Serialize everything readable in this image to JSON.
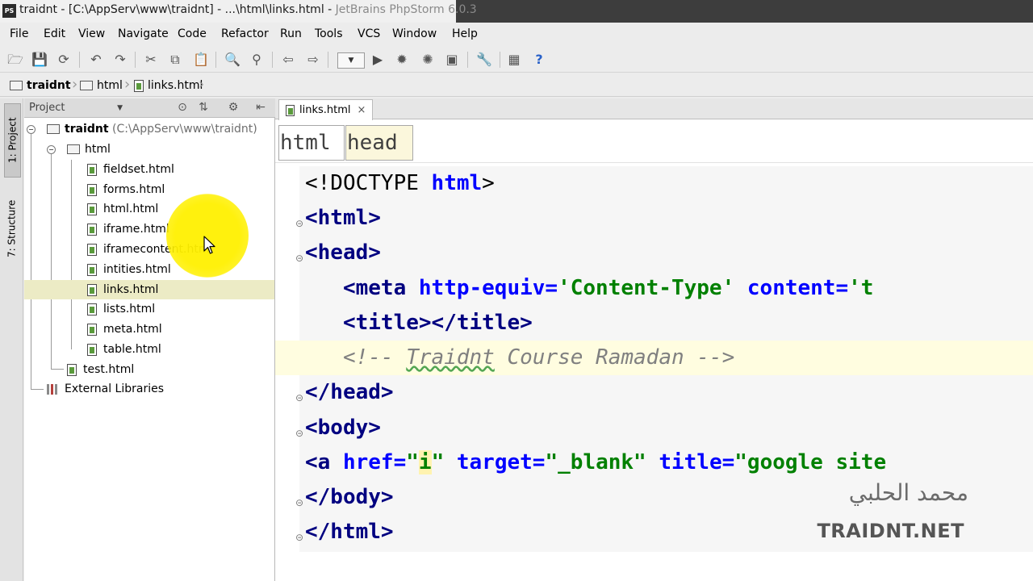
{
  "window": {
    "title_main": "traidnt - [C:\\AppServ\\www\\traidnt] - ...\\html\\links.html - ",
    "title_app": "JetBrains PhpStorm 6.0.3",
    "app_icon_text": "PS"
  },
  "menu": [
    "File",
    "Edit",
    "View",
    "Navigate",
    "Code",
    "Refactor",
    "Run",
    "Tools",
    "VCS",
    "Window",
    "Help"
  ],
  "toolbar": {
    "icons": [
      "open-folder-icon",
      "save-all-icon",
      "synchronize-icon",
      "undo-icon",
      "redo-icon",
      "cut-icon",
      "copy-icon",
      "paste-icon",
      "find-icon",
      "replace-icon",
      "back-icon",
      "forward-icon",
      "run-icon",
      "debug-icon",
      "coverage-icon",
      "stop-icon",
      "settings-icon",
      "project-structure-icon",
      "help-icon"
    ],
    "run_config_label": "▼",
    "help_label": "?"
  },
  "breadcrumb": {
    "project": "traidnt",
    "folder": "html",
    "file": "links.html"
  },
  "tool_windows": {
    "project_tab": "1: Project",
    "structure_tab": "7: Structure"
  },
  "project_panel": {
    "title": "Project",
    "root_name": "traidnt",
    "root_path": "(C:\\AppServ\\www\\traidnt)",
    "folder": "html",
    "files": [
      "fieldset.html",
      "forms.html",
      "html.html",
      "iframe.html",
      "iframecontent.html",
      "intities.html",
      "links.html",
      "lists.html",
      "meta.html",
      "table.html"
    ],
    "selected_file": "links.html",
    "root_file": "test.html",
    "external": "External Libraries"
  },
  "editor": {
    "tab_label": "links.html",
    "tab_close": "×",
    "crumbs": [
      "html",
      "head"
    ],
    "code": {
      "doctype": "<!DOCTYPE ",
      "doctype_html": "html",
      "doctype_end": ">",
      "html_open": "<html>",
      "head_open": "<head>",
      "meta_open": "<meta ",
      "meta_attr1": "http-equiv=",
      "meta_val1": "'Content-Type'",
      "meta_attr2": " content=",
      "meta_val2": "'t",
      "title_tags": "<title></title>",
      "comment_open": "<!-- ",
      "comment_word": "Traidnt",
      "comment_rest": " Course Ramadan -->",
      "head_close": "</head>",
      "body_open": "<body>",
      "a_open": "<a ",
      "a_href": "href=",
      "a_href_q1": "\"",
      "a_href_val": "i",
      "a_href_q2": "\"",
      "a_target": " target=",
      "a_target_val": "\"_blank\"",
      "a_title": " title=",
      "a_title_val": "\"google site",
      "body_close": "</body>",
      "html_close": "</html>"
    }
  },
  "watermark": {
    "arabic": "محمد الحلبي",
    "latin": "TRAIDNT.NET"
  }
}
